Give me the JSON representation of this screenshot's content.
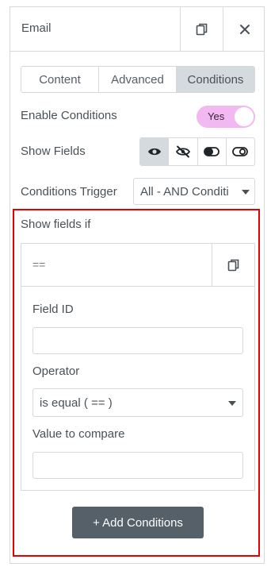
{
  "header": {
    "title": "Email"
  },
  "tabs": [
    {
      "label": "Content"
    },
    {
      "label": "Advanced"
    },
    {
      "label": "Conditions"
    }
  ],
  "enable_conditions": {
    "label": "Enable Conditions",
    "toggle_text": "Yes",
    "toggle_color": "#f1b8f1"
  },
  "show_fields": {
    "label": "Show Fields",
    "icons": [
      "eye-icon",
      "eye-slash-icon",
      "toggle-on-icon",
      "toggle-off-icon"
    ],
    "active_index": 0
  },
  "conditions_trigger": {
    "label": "Conditions Trigger",
    "value": "All - AND Conditi"
  },
  "condition_group": {
    "label": "Show fields if",
    "item": {
      "title": "==",
      "field_id": {
        "label": "Field ID",
        "value": ""
      },
      "operator": {
        "label": "Operator",
        "value": "is equal ( == )"
      },
      "value_to_compare": {
        "label": "Value to compare",
        "value": ""
      }
    },
    "add_button": "+ Add Conditions"
  },
  "colors": {
    "highlight_border": "#e60000",
    "active_tab_bg": "#d5dadf",
    "button_bg": "#556068"
  }
}
